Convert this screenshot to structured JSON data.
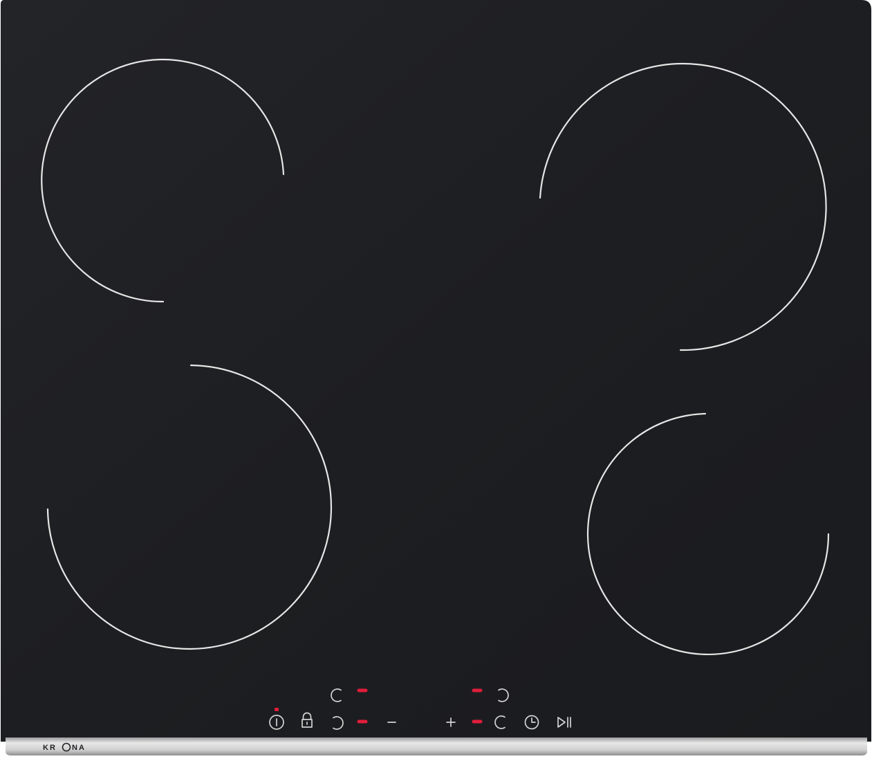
{
  "product": {
    "brand_left": "KR",
    "brand_right": "NA",
    "surface_color": "#1f2023",
    "frame_color": "#c8c8c8",
    "indicator_color": "#e01d3a"
  },
  "zones": [
    {
      "id": "front-left",
      "position": "rear-left"
    },
    {
      "id": "rear-right",
      "position": "rear-right"
    },
    {
      "id": "front-left",
      "position": "front-left"
    },
    {
      "id": "front-right",
      "position": "front-right"
    }
  ],
  "controls": [
    {
      "icon": "power-icon",
      "function": "power"
    },
    {
      "icon": "lock-icon",
      "function": "child-lock"
    },
    {
      "icon": "zone-selector-icon",
      "function": "zone-select"
    },
    {
      "icon": "minus-icon",
      "function": "decrease"
    },
    {
      "icon": "plus-icon",
      "function": "increase"
    },
    {
      "icon": "timer-icon",
      "function": "timer"
    },
    {
      "icon": "play-pause-icon",
      "function": "pause"
    }
  ],
  "indicators": {
    "power_led": "on",
    "zone_leds": [
      "on",
      "on",
      "on",
      "on"
    ]
  }
}
